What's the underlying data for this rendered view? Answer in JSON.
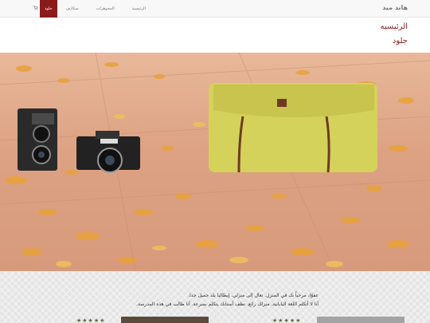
{
  "navbar": {
    "brand": "هاند ميد",
    "items": [
      {
        "label": "الرئيسية"
      },
      {
        "label": "المجوهرات"
      },
      {
        "label": "سكارف"
      },
      {
        "label": "جلود",
        "active": true
      }
    ],
    "cart_icon": "shopping-cart-icon"
  },
  "header": {
    "title": "الرئيسيه",
    "subtitle": "جلود"
  },
  "testimonials": {
    "line1": "عفوًا، مرحباً بك في المنزل. تعال إلى منزلي. إيطاليا بلد جميل جدا.",
    "line2": "أنا لا أتكلم اللغة اليابانية. منزلك رائع. نظف أسنانك يتكلم بسرعة. أنا طالب في هذه المدرسة.",
    "stars_left": "★★★★★",
    "stars_right": "★★★★★"
  },
  "colors": {
    "accent": "#8b1a1a",
    "navbar_bg": "#f8f8f8"
  }
}
